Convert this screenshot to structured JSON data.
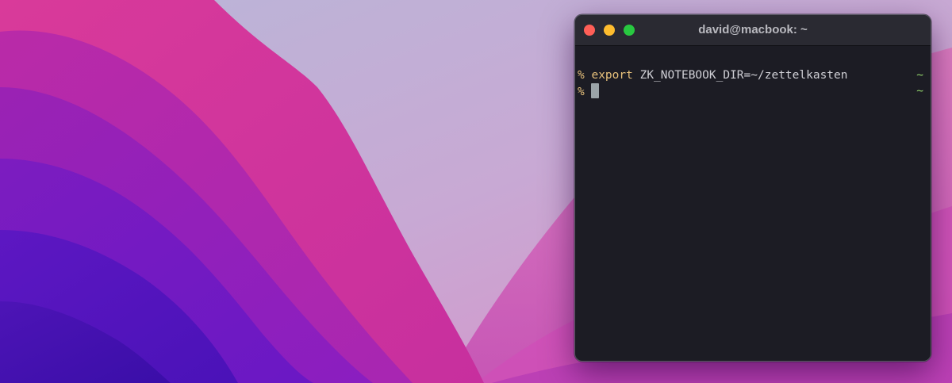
{
  "window": {
    "title": "david@macbook: ~"
  },
  "terminal": {
    "lines": [
      {
        "prompt": "%",
        "command": "export",
        "args": "ZK_NOTEBOOK_DIR=~/zettelkasten",
        "right_prompt": "~"
      },
      {
        "prompt": "%",
        "command": "",
        "args": "",
        "right_prompt": "~"
      }
    ]
  },
  "colors": {
    "close": "#ff5f57",
    "minimize": "#febc2e",
    "zoom": "#28c840",
    "prompt": "#e6c07b",
    "right_prompt": "#8fcf6a",
    "background": "#1c1c24"
  }
}
